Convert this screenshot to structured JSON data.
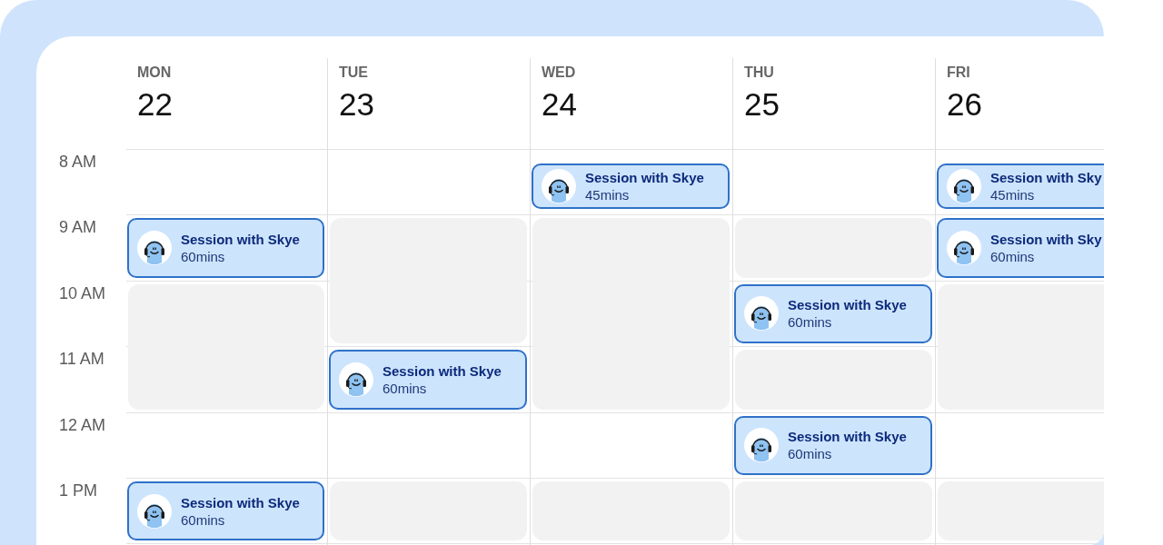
{
  "time_labels": [
    "8 AM",
    "9 AM",
    "10 AM",
    "11 AM",
    "12 AM",
    "1 PM"
  ],
  "days": [
    {
      "name": "MON",
      "date": "22",
      "slots": [
        {
          "kind": "free"
        },
        {
          "kind": "event",
          "title": "Session with Skye",
          "duration": "60mins",
          "short": false
        },
        {
          "kind": "busy"
        },
        {
          "kind": "busy"
        },
        {
          "kind": "free"
        },
        {
          "kind": "event",
          "title": "Session with Skye",
          "duration": "60mins",
          "short": false
        }
      ]
    },
    {
      "name": "TUE",
      "date": "23",
      "slots": [
        {
          "kind": "free"
        },
        {
          "kind": "busy"
        },
        {
          "kind": "busy"
        },
        {
          "kind": "event",
          "title": "Session with Skye",
          "duration": "60mins",
          "short": false
        },
        {
          "kind": "free"
        },
        {
          "kind": "busy"
        }
      ]
    },
    {
      "name": "WED",
      "date": "24",
      "slots": [
        {
          "kind": "event",
          "title": "Session with Skye",
          "duration": "45mins",
          "short": true
        },
        {
          "kind": "busy"
        },
        {
          "kind": "busy"
        },
        {
          "kind": "busy"
        },
        {
          "kind": "free"
        },
        {
          "kind": "busy"
        }
      ]
    },
    {
      "name": "THU",
      "date": "25",
      "slots": [
        {
          "kind": "free"
        },
        {
          "kind": "busy"
        },
        {
          "kind": "event",
          "title": "Session with Skye",
          "duration": "60mins",
          "short": false
        },
        {
          "kind": "busy"
        },
        {
          "kind": "event",
          "title": "Session with Skye",
          "duration": "60mins",
          "short": false
        },
        {
          "kind": "busy"
        }
      ]
    },
    {
      "name": "FRI",
      "date": "26",
      "slots": [
        {
          "kind": "event",
          "title": "Session with Sky",
          "duration": "45mins",
          "short": true
        },
        {
          "kind": "event",
          "title": "Session with Sky",
          "duration": "60mins",
          "short": false
        },
        {
          "kind": "busy"
        },
        {
          "kind": "busy"
        },
        {
          "kind": "free"
        },
        {
          "kind": "busy"
        }
      ]
    }
  ]
}
